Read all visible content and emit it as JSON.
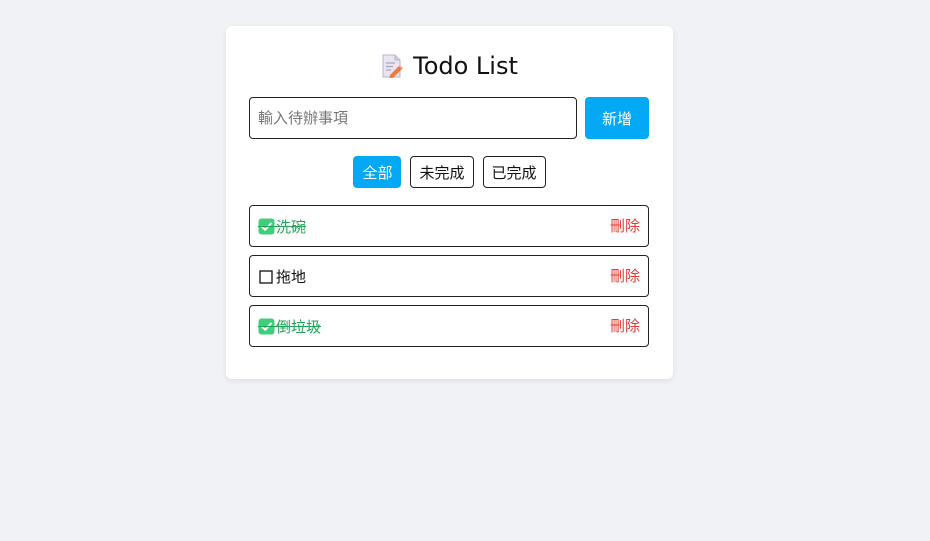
{
  "header": {
    "icon": "memo-icon",
    "title": "Todo List"
  },
  "add_form": {
    "placeholder": "輸入待辦事項",
    "value": "",
    "add_label": "新增"
  },
  "filters": {
    "active": "all",
    "all_label": "全部",
    "incomplete_label": "未完成",
    "complete_label": "已完成"
  },
  "todos": [
    {
      "text": "洗碗",
      "done": true,
      "delete_label": "刪除"
    },
    {
      "text": "拖地",
      "done": false,
      "delete_label": "刪除"
    },
    {
      "text": "倒垃圾",
      "done": true,
      "delete_label": "刪除"
    }
  ],
  "colors": {
    "accent": "#03a9f4",
    "done_text": "#22a55a",
    "delete": "#e53935",
    "background": "#f0f2f5"
  }
}
